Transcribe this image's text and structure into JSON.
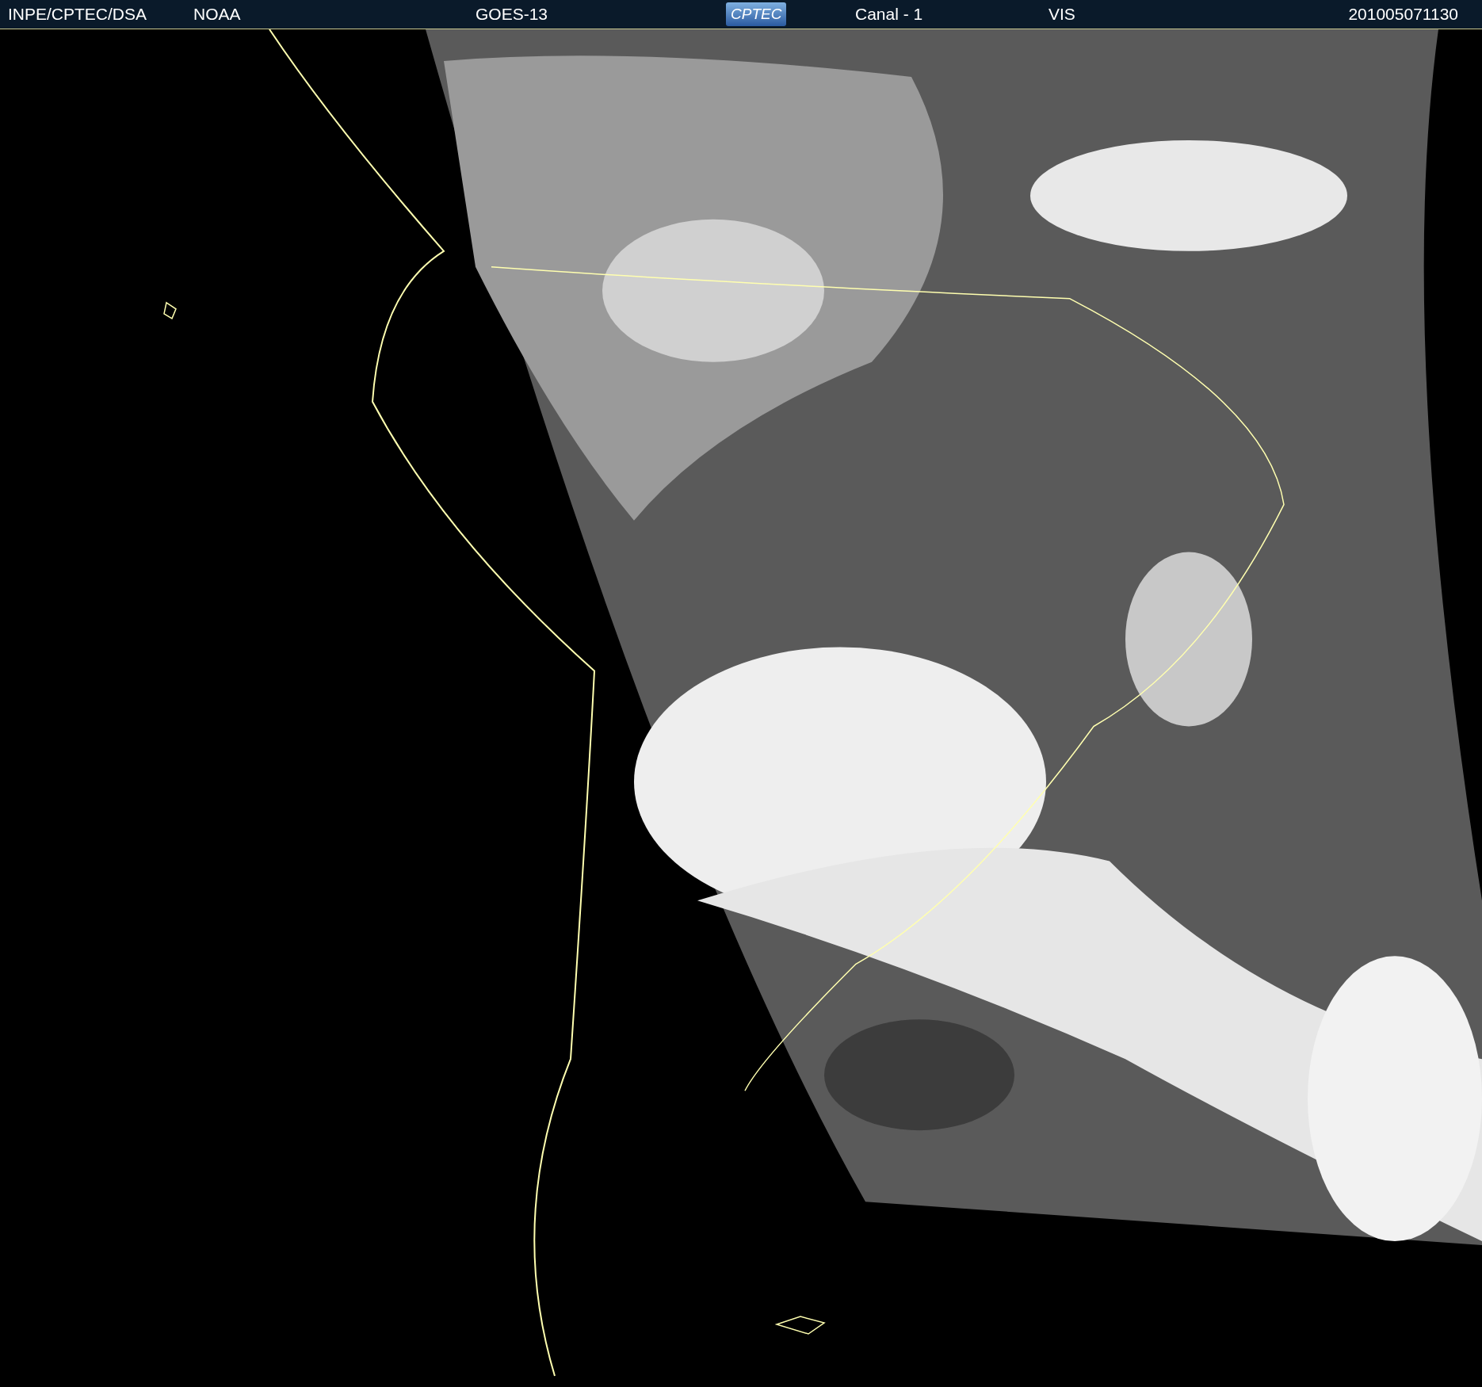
{
  "header": {
    "items": [
      {
        "kind": "text",
        "text": "INPE/CPTEC/DSA"
      },
      {
        "kind": "text",
        "text": "NOAA"
      },
      {
        "kind": "text",
        "text": "GOES-13"
      },
      {
        "kind": "logo",
        "text": "CPTEC"
      },
      {
        "kind": "text",
        "text": "Canal - 1"
      },
      {
        "kind": "text",
        "text": "VIS"
      },
      {
        "kind": "text",
        "text": "201005071130"
      }
    ]
  }
}
